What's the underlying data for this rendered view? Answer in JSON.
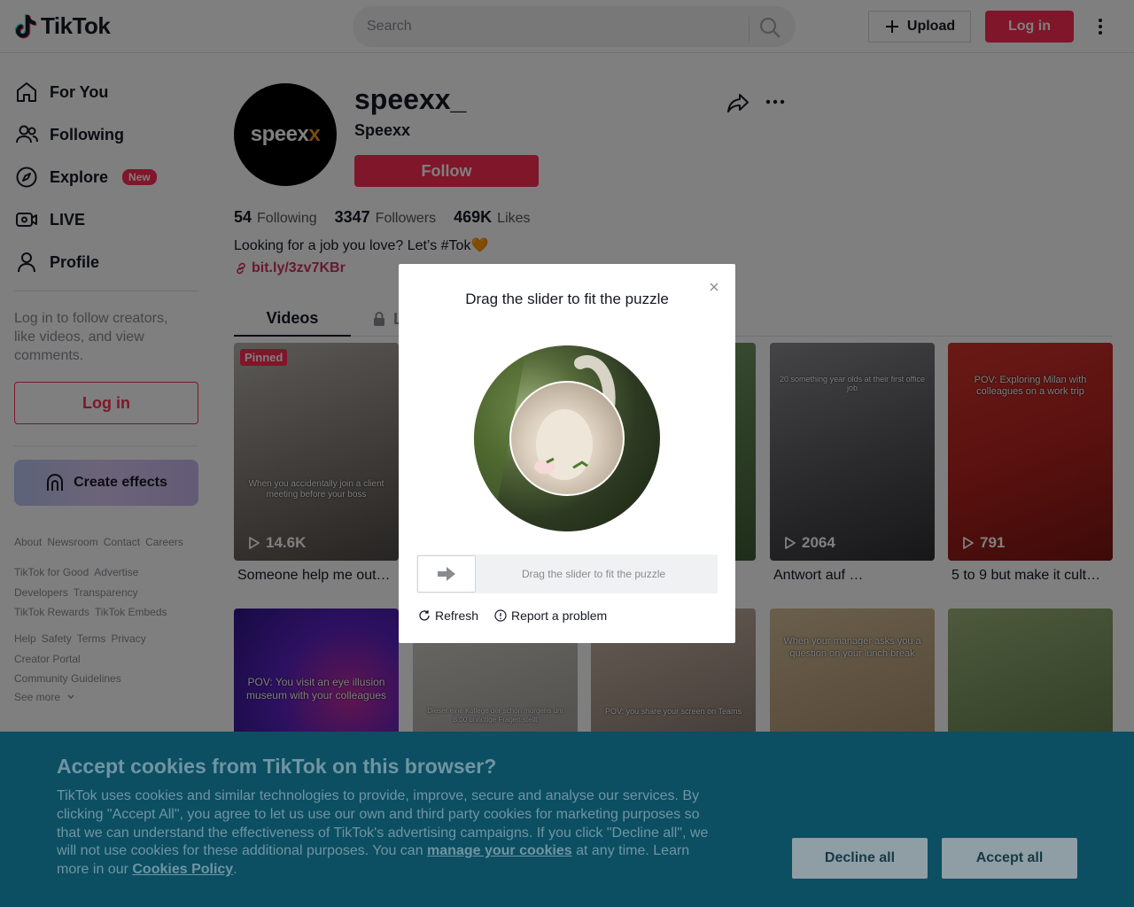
{
  "header": {
    "logo_text": "TikTok",
    "search_placeholder": "Search",
    "upload_label": "Upload",
    "login_label": "Log in"
  },
  "sidebar": {
    "items": [
      {
        "label": "For You",
        "icon": "home-icon"
      },
      {
        "label": "Following",
        "icon": "people-icon"
      },
      {
        "label": "Explore",
        "icon": "compass-icon",
        "badge": "New"
      },
      {
        "label": "LIVE",
        "icon": "live-icon"
      },
      {
        "label": "Profile",
        "icon": "user-icon"
      }
    ],
    "login_prompt": "Log in to follow creators, like videos, and view comments.",
    "login_button": "Log in",
    "create_effects": "Create effects",
    "footer_row1": [
      "About",
      "Newsroom",
      "Contact",
      "Careers"
    ],
    "footer_row2": [
      "TikTok for Good",
      "Advertise",
      "Developers",
      "Transparency",
      "TikTok Rewards",
      "TikTok Embeds"
    ],
    "footer_row3": [
      "Help",
      "Safety",
      "Terms",
      "Privacy",
      "Creator Portal",
      "Community Guidelines"
    ],
    "see_more": "See more"
  },
  "profile": {
    "avatar_text": "speex",
    "avatar_text_accent": "x",
    "username": "speexx_",
    "nickname": "Speexx",
    "follow_label": "Follow",
    "following_count": "54",
    "following_label": "Following",
    "followers_count": "3347",
    "followers_label": "Followers",
    "likes_count": "469K",
    "likes_label": "Likes",
    "bio": "Looking for a job you love? Let’s #Tok🧡",
    "link": "bit.ly/3zv7KBr"
  },
  "tabs": {
    "videos": "Videos",
    "liked": "L"
  },
  "videos": [
    {
      "caption": "When you accidentally join a client meeting before your boss",
      "views": "14.6K",
      "title": "Someone help me out…",
      "pinned": "Pinned",
      "bg": "#7f7a72"
    },
    {
      "caption": "",
      "views": "",
      "title": "",
      "bg": "#6b7f4a"
    },
    {
      "caption": "",
      "views": "",
      "title": "",
      "bg": "#56734a"
    },
    {
      "caption": "20 something year olds at their first office job",
      "views": "2064",
      "title": "Antwort auf …",
      "bg": "#5a5a5e"
    },
    {
      "caption": "POV: Exploring Milan with colleagues on a work trip",
      "views": "791",
      "title": "5 to 9 but make it cult…",
      "bg": "#b4231f"
    },
    {
      "caption": "POV: You visit an eye illusion museum with your colleagues",
      "views": "",
      "title": "",
      "bg": "#3b1d8a"
    },
    {
      "caption": "Dieser eine Kollege der schon morgens um 8:00 unnötige Fragen stellt",
      "views": "",
      "title": "",
      "bg": "#a9a69f"
    },
    {
      "caption": "POV: you share your screen on Teams",
      "views": "",
      "title": "",
      "bg": "#7d7168"
    },
    {
      "caption": "When your manager asks you a question on your lunch break",
      "views": "",
      "title": "",
      "bg": "#b49a78"
    },
    {
      "caption": "",
      "views": "",
      "title": "",
      "bg": "#6f8a5c"
    }
  ],
  "captcha": {
    "title": "Drag the slider to fit the puzzle",
    "slider_text": "Drag the slider to fit the puzzle",
    "refresh": "Refresh",
    "report": "Report a problem"
  },
  "cookie": {
    "title": "Accept cookies from TikTok on this browser?",
    "text_before": "TikTok uses cookies and similar technologies to provide, improve, secure and analyse our services. By clicking \"Accept All\", you agree to let us use our own and third party cookies for marketing purposes so that we can understand the effectiveness of TikTok's advertising campaigns. If you click \"Decline all\", we will not use cookies for these additional purposes. You can ",
    "manage_link": "manage your cookies",
    "text_middle": " at any time. Learn more in our ",
    "policy_link": "Cookies Policy",
    "text_after": ".",
    "decline": "Decline all",
    "accept": "Accept all"
  },
  "colors": {
    "brand": "#fe2c55",
    "cookie_bg": "#0c4e62"
  }
}
